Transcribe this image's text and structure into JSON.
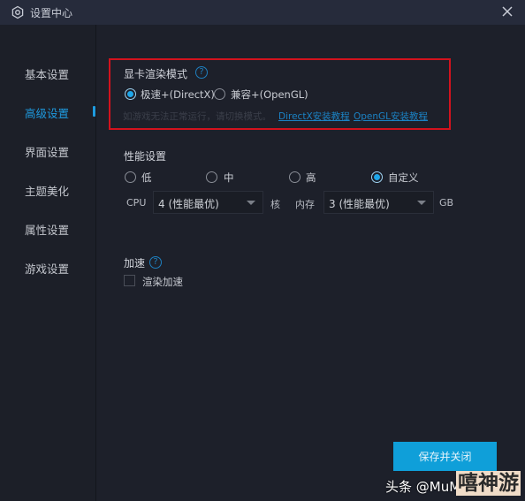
{
  "window": {
    "title": "设置中心",
    "icon": "gear-hexagon-icon",
    "close_icon": "close-icon"
  },
  "sidebar": {
    "items": [
      {
        "label": "基本设置",
        "active": false
      },
      {
        "label": "高级设置",
        "active": true
      },
      {
        "label": "界面设置",
        "active": false
      },
      {
        "label": "主题美化",
        "active": false
      },
      {
        "label": "属性设置",
        "active": false
      },
      {
        "label": "游戏设置",
        "active": false
      }
    ],
    "accent_color": "#1e9be0"
  },
  "render_mode": {
    "title": "显卡渲染模式",
    "help_glyph": "?",
    "options": [
      {
        "label": "极速+(DirectX)",
        "checked": true
      },
      {
        "label": "兼容+(OpenGL)",
        "checked": false
      }
    ],
    "hint": "如游戏无法正常运行，请切换模式。",
    "links": [
      {
        "label": "DirectX安装教程"
      },
      {
        "label": "OpenGL安装教程"
      }
    ],
    "highlight_color": "#d3121d"
  },
  "performance": {
    "title": "性能设置",
    "options": [
      {
        "label": "低",
        "checked": false
      },
      {
        "label": "中",
        "checked": false
      },
      {
        "label": "高",
        "checked": false
      },
      {
        "label": "自定义",
        "checked": true
      }
    ],
    "cpu": {
      "label": "CPU",
      "value": "4 (性能最优)",
      "unit": "核"
    },
    "memory": {
      "label": "内存",
      "value": "3 (性能最优)",
      "unit": "GB"
    }
  },
  "acceleration": {
    "title": "加速",
    "help_glyph": "?",
    "checkbox_label": "渲染加速",
    "checked": false
  },
  "footer": {
    "save_label": "保存并关闭",
    "button_color": "#0f9fd9"
  },
  "watermark": {
    "left": "头条 @MuMu",
    "right": "嘻神游"
  }
}
